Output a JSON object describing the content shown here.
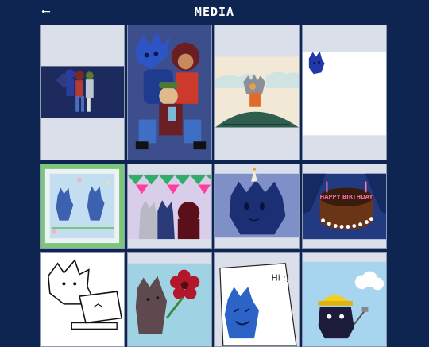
{
  "header": {
    "title": "MEDIA",
    "back_icon": "arrow-left-icon"
  },
  "colors": {
    "background": "#0d2550",
    "tile_letterbox": "#dadfe9",
    "tile_border": "#8d9ab3"
  },
  "media": {
    "items": [
      {
        "id": "1",
        "caption": "",
        "text": ""
      },
      {
        "id": "2",
        "caption": "",
        "text": ""
      },
      {
        "id": "3",
        "caption": "",
        "text": ""
      },
      {
        "id": "4",
        "caption": "",
        "text": ""
      },
      {
        "id": "5",
        "caption": "",
        "text": ""
      },
      {
        "id": "6",
        "caption": "",
        "text": ""
      },
      {
        "id": "7",
        "caption": "",
        "text": ""
      },
      {
        "id": "8",
        "caption": "",
        "text": "HAPPY BIRTHDAY"
      },
      {
        "id": "9",
        "caption": "",
        "text": ""
      },
      {
        "id": "10",
        "caption": "",
        "text": ""
      },
      {
        "id": "11",
        "caption": "",
        "text": "Hi :)"
      },
      {
        "id": "12",
        "caption": "",
        "text": ""
      }
    ]
  }
}
